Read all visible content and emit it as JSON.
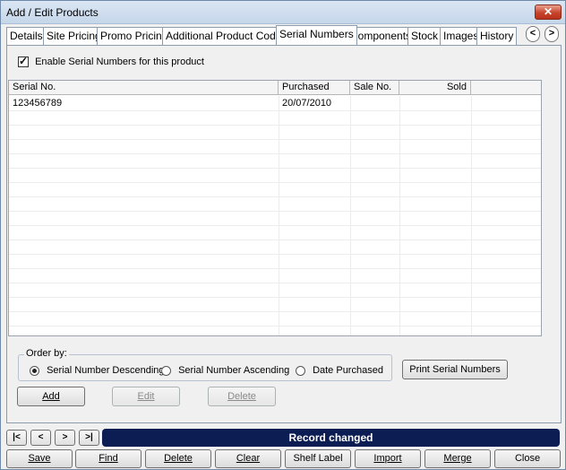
{
  "window": {
    "title": "Add / Edit Products",
    "close_glyph": "✕"
  },
  "tabs": [
    {
      "label": "Details"
    },
    {
      "label": "Site Pricing"
    },
    {
      "label": "Promo Pricing"
    },
    {
      "label": "Additional Product Codes"
    },
    {
      "label": "Serial Numbers"
    },
    {
      "label": "Components"
    },
    {
      "label": "Stock"
    },
    {
      "label": "Images"
    },
    {
      "label": "History"
    }
  ],
  "tab_nav": {
    "prev": "<",
    "next": ">"
  },
  "serial": {
    "enable_label": "Enable Serial Numbers for this product",
    "enabled": true
  },
  "grid": {
    "columns": [
      "Serial No.",
      "Purchased",
      "Sale No.",
      "Sold"
    ],
    "rows": [
      {
        "serial": "123456789",
        "purchased": "20/07/2010",
        "sale_no": "",
        "sold": ""
      }
    ]
  },
  "order_by": {
    "legend": "Order by:",
    "options": [
      {
        "label": "Serial Number Descending",
        "selected": true
      },
      {
        "label": "Serial Number Ascending",
        "selected": false
      },
      {
        "label": "Date Purchased",
        "selected": false
      }
    ]
  },
  "actions": {
    "print_serials": "Print Serial Numbers",
    "add": "Add",
    "edit": "Edit",
    "delete": "Delete"
  },
  "record_nav": {
    "first": "|<",
    "prev": "<",
    "next": ">",
    "last": ">|",
    "status": "Record changed"
  },
  "bottom_buttons": {
    "save": "Save",
    "find": "Find",
    "delete": "Delete",
    "clear": "Clear",
    "shelf_label": "Shelf Label",
    "import": "Import",
    "merge": "Merge",
    "close": "Close"
  },
  "colors": {
    "status_bar": "#0b1d52",
    "close_button": "#c7432a"
  }
}
